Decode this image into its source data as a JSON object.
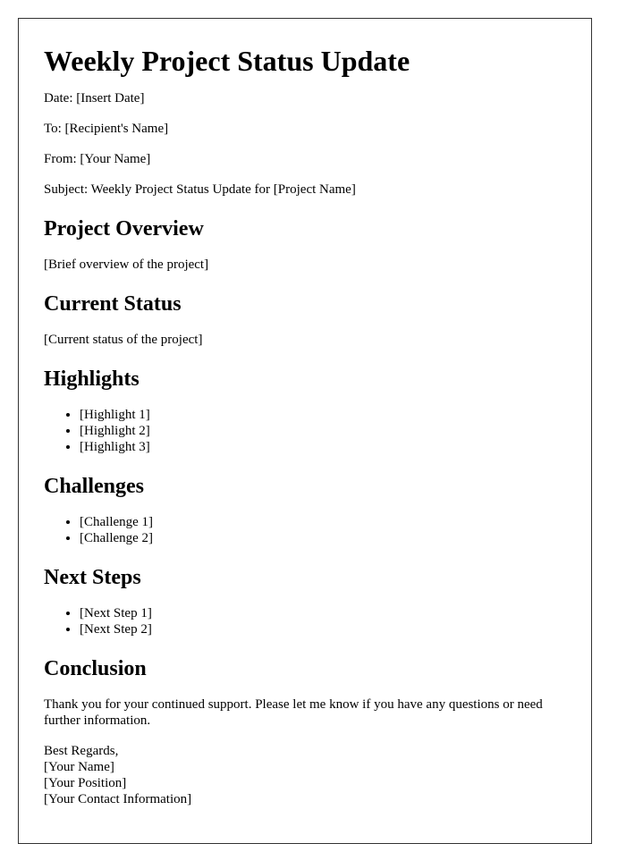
{
  "title": "Weekly Project Status Update",
  "meta": {
    "date": "Date: [Insert Date]",
    "to": "To: [Recipient's Name]",
    "from": "From: [Your Name]",
    "subject": "Subject: Weekly Project Status Update for [Project Name]"
  },
  "sections": {
    "overview": {
      "heading": "Project Overview",
      "text": "[Brief overview of the project]"
    },
    "status": {
      "heading": "Current Status",
      "text": "[Current status of the project]"
    },
    "highlights": {
      "heading": "Highlights",
      "items": [
        "[Highlight 1]",
        "[Highlight 2]",
        "[Highlight 3]"
      ]
    },
    "challenges": {
      "heading": "Challenges",
      "items": [
        "[Challenge 1]",
        "[Challenge 2]"
      ]
    },
    "next_steps": {
      "heading": "Next Steps",
      "items": [
        "[Next Step 1]",
        "[Next Step 2]"
      ]
    },
    "conclusion": {
      "heading": "Conclusion",
      "text": "Thank you for your continued support. Please let me know if you have any questions or need further information."
    }
  },
  "signature": {
    "closing": "Best Regards,",
    "name": "[Your Name]",
    "position": "[Your Position]",
    "contact": "[Your Contact Information]"
  }
}
